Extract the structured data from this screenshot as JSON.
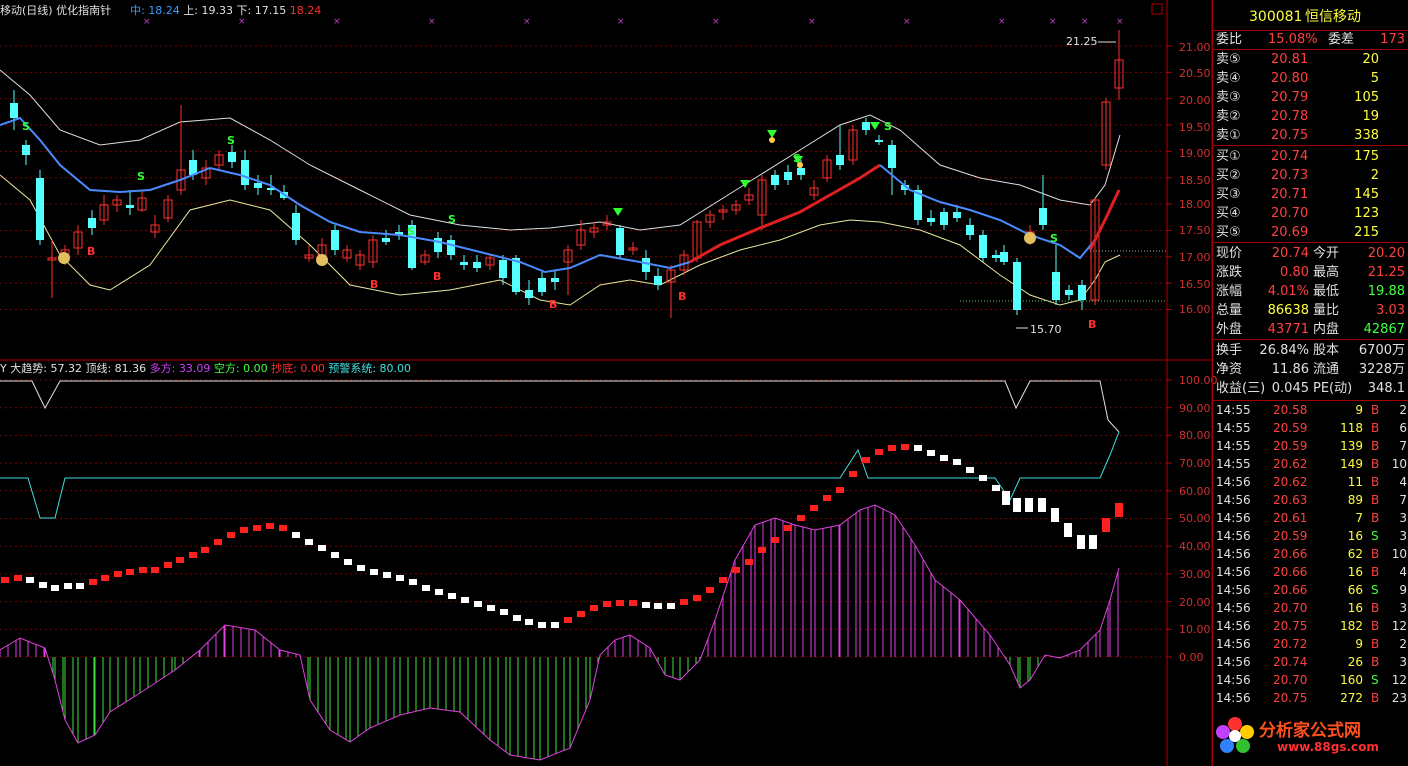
{
  "header": {
    "title": "移动(日线) 优化指南针",
    "mid_label": "中:",
    "mid_value": "18.24",
    "up_label": "上:",
    "up_value": "19.33",
    "down_label": "下:",
    "down_value": "17.15",
    "last_value": "18.24"
  },
  "price_axis": [
    "21.00",
    "20.50",
    "20.00",
    "19.50",
    "19.00",
    "18.50",
    "18.00",
    "17.50",
    "17.00",
    "16.50",
    "16.00"
  ],
  "price_marks": {
    "high": "21.25",
    "low": "15.70"
  },
  "indicator": {
    "prefix": "Y",
    "name": "大趋势:",
    "name_value": "57.32",
    "top_label": "顶线:",
    "top_value": "81.36",
    "long_label": "多方:",
    "long_value": "33.09",
    "short_label": "空方:",
    "short_value": "0.00",
    "bottom_label": "抄底:",
    "bottom_value": "0.00",
    "warn_label": "预警系统:",
    "warn_value": "80.00"
  },
  "indicator_axis": [
    "100.00",
    "90.00",
    "80.00",
    "70.00",
    "60.00",
    "50.00",
    "40.00",
    "30.00",
    "20.00",
    "10.00",
    "0.00"
  ],
  "signals": {
    "buy": "B",
    "sell": "S"
  },
  "stock": {
    "code": "300081",
    "name": "恒信移动"
  },
  "book": {
    "ratio_label": "委比",
    "ratio_value": "15.08%",
    "diff_label": "委差",
    "diff_value": "173",
    "asks": [
      {
        "label": "卖⑤",
        "price": "20.81",
        "vol": "20"
      },
      {
        "label": "卖④",
        "price": "20.80",
        "vol": "5"
      },
      {
        "label": "卖③",
        "price": "20.79",
        "vol": "105"
      },
      {
        "label": "卖②",
        "price": "20.78",
        "vol": "19"
      },
      {
        "label": "卖①",
        "price": "20.75",
        "vol": "338"
      }
    ],
    "bids": [
      {
        "label": "买①",
        "price": "20.74",
        "vol": "175"
      },
      {
        "label": "买②",
        "price": "20.73",
        "vol": "2"
      },
      {
        "label": "买③",
        "price": "20.71",
        "vol": "145"
      },
      {
        "label": "买④",
        "price": "20.70",
        "vol": "123"
      },
      {
        "label": "买⑤",
        "price": "20.69",
        "vol": "215"
      }
    ]
  },
  "quote": [
    {
      "l1": "现价",
      "v1": "20.74",
      "l2": "今开",
      "v2": "20.20"
    },
    {
      "l1": "涨跌",
      "v1": "0.80",
      "l2": "最高",
      "v2": "21.25"
    },
    {
      "l1": "涨幅",
      "v1": "4.01%",
      "l2": "最低",
      "v2": "19.88"
    },
    {
      "l1": "总量",
      "v1": "86638",
      "l2": "量比",
      "v2": "3.03"
    },
    {
      "l1": "外盘",
      "v1": "43771",
      "l2": "内盘",
      "v2": "42867"
    }
  ],
  "stats": [
    {
      "l1": "换手",
      "v1": "26.84%",
      "l2": "股本",
      "v2": "6700万"
    },
    {
      "l1": "净资",
      "v1": "11.86",
      "l2": "流通",
      "v2": "3228万"
    },
    {
      "l1": "收益(三)",
      "v1": "0.045",
      "l2": "PE(动)",
      "v2": "348.1"
    }
  ],
  "ticks": [
    {
      "t": "14:55",
      "p": "20.58",
      "v": "9",
      "s": "B",
      "n": "2"
    },
    {
      "t": "14:55",
      "p": "20.59",
      "v": "118",
      "s": "B",
      "n": "6"
    },
    {
      "t": "14:55",
      "p": "20.59",
      "v": "139",
      "s": "B",
      "n": "7"
    },
    {
      "t": "14:55",
      "p": "20.62",
      "v": "149",
      "s": "B",
      "n": "10"
    },
    {
      "t": "14:56",
      "p": "20.62",
      "v": "11",
      "s": "B",
      "n": "4"
    },
    {
      "t": "14:56",
      "p": "20.63",
      "v": "89",
      "s": "B",
      "n": "7"
    },
    {
      "t": "14:56",
      "p": "20.61",
      "v": "7",
      "s": "B",
      "n": "3"
    },
    {
      "t": "14:56",
      "p": "20.59",
      "v": "16",
      "s": "S",
      "n": "3"
    },
    {
      "t": "14:56",
      "p": "20.66",
      "v": "62",
      "s": "B",
      "n": "10"
    },
    {
      "t": "14:56",
      "p": "20.66",
      "v": "16",
      "s": "B",
      "n": "4"
    },
    {
      "t": "14:56",
      "p": "20.66",
      "v": "66",
      "s": "S",
      "n": "9"
    },
    {
      "t": "14:56",
      "p": "20.70",
      "v": "16",
      "s": "B",
      "n": "3"
    },
    {
      "t": "14:56",
      "p": "20.75",
      "v": "182",
      "s": "B",
      "n": "12"
    },
    {
      "t": "14:56",
      "p": "20.72",
      "v": "9",
      "s": "B",
      "n": "2"
    },
    {
      "t": "14:56",
      "p": "20.74",
      "v": "26",
      "s": "B",
      "n": "3"
    },
    {
      "t": "14:56",
      "p": "20.70",
      "v": "160",
      "s": "S",
      "n": "12"
    },
    {
      "t": "14:56",
      "p": "20.75",
      "v": "272",
      "s": "B",
      "n": "23"
    }
  ],
  "watermark": {
    "name": "分析家公式网",
    "url": "www.88gs.com"
  }
}
